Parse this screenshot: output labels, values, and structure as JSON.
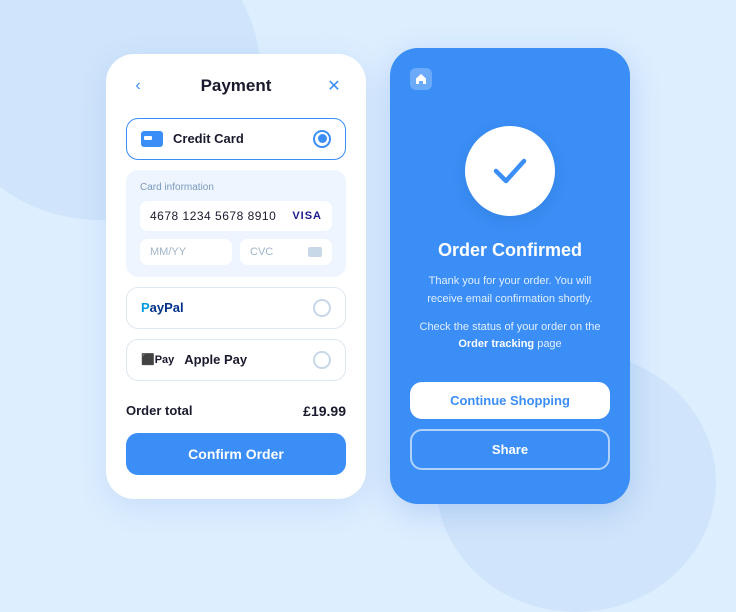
{
  "background": {
    "color": "#ddeeff"
  },
  "payment_screen": {
    "title": "Payment",
    "back_icon": "‹",
    "close_icon": "✕",
    "credit_card_option": {
      "label": "Credit Card",
      "selected": true
    },
    "card_info": {
      "section_label": "Card information",
      "card_number": "4678 1234 5678 8910",
      "card_brand": "VISA",
      "expiry_placeholder": "MM/YY",
      "cvc_placeholder": "CVC"
    },
    "paypal_option": {
      "label": "PayPal",
      "selected": false
    },
    "apple_pay_option": {
      "label": "Apple Pay",
      "selected": false
    },
    "order_total": {
      "label": "Order total",
      "value": "£19.99"
    },
    "confirm_button": "Confirm Order"
  },
  "confirmed_screen": {
    "home_icon": "⌂",
    "title": "Order Confirmed",
    "description_1": "Thank you for your order. You will receive email confirmation shortly.",
    "description_2_prefix": "Check the status of your order on the ",
    "description_2_link": "Order tracking",
    "description_2_suffix": " page",
    "continue_button": "Continue Shopping",
    "share_button": "Share"
  }
}
